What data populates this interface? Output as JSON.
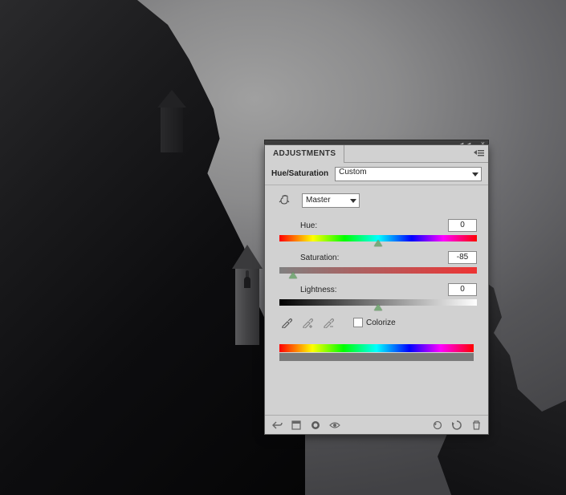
{
  "panel": {
    "tab_label": "ADJUSTMENTS",
    "title": "Hue/Saturation",
    "preset": "Custom",
    "channel": "Master",
    "hue": {
      "label": "Hue:",
      "value": "0",
      "pos_pct": 50
    },
    "saturation": {
      "label": "Saturation:",
      "value": "-85",
      "pos_pct": 7
    },
    "lightness": {
      "label": "Lightness:",
      "value": "0",
      "pos_pct": 50
    },
    "colorize_label": "Colorize"
  }
}
